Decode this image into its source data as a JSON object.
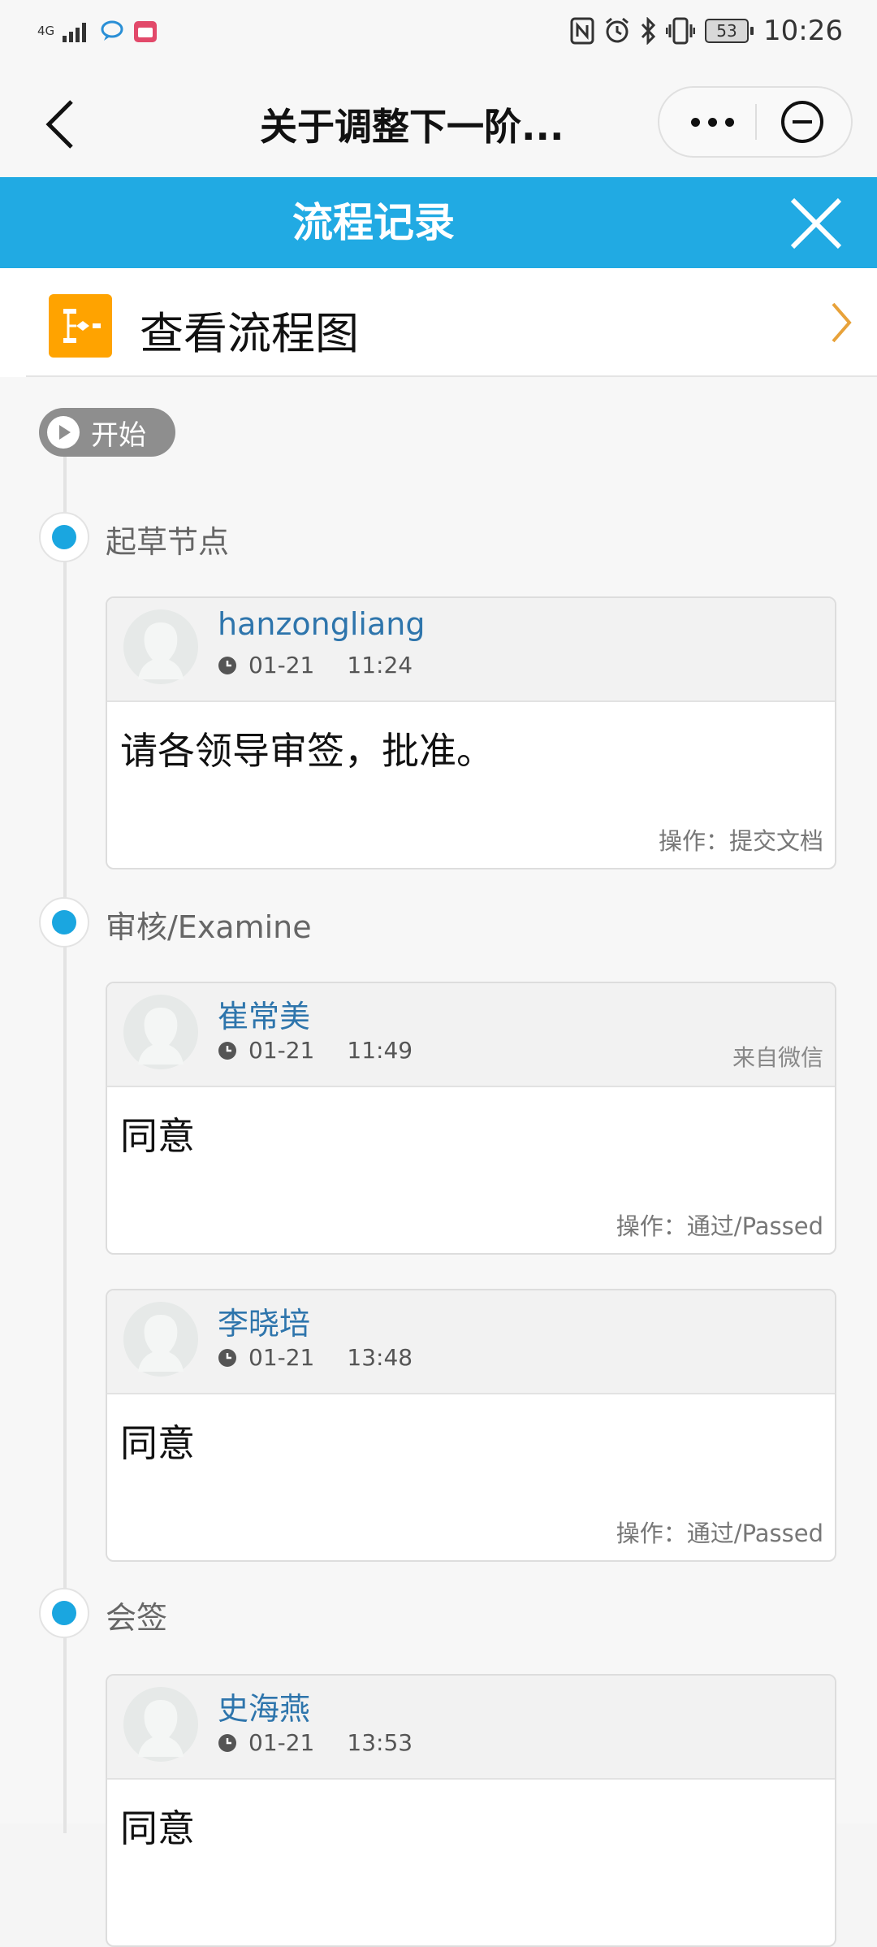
{
  "status_bar": {
    "network": "4G",
    "battery": "53",
    "time": "10:26"
  },
  "nav": {
    "title": "关于调整下一阶..."
  },
  "header": {
    "title": "流程记录"
  },
  "view_diagram": {
    "label": "查看流程图"
  },
  "start": {
    "label": "开始"
  },
  "nodes": [
    {
      "label": "起草节点",
      "entries": [
        {
          "user": "hanzongliang",
          "date": "01-21",
          "time": "11:24",
          "source": "",
          "comment": "请各领导审签，批准。",
          "operation": "操作：提交文档"
        }
      ]
    },
    {
      "label": "审核/Examine",
      "entries": [
        {
          "user": "崔常美",
          "date": "01-21",
          "time": "11:49",
          "source": "来自微信",
          "comment": "同意",
          "operation": "操作：通过/Passed"
        },
        {
          "user": "李晓培",
          "date": "01-21",
          "time": "13:48",
          "source": "",
          "comment": "同意",
          "operation": "操作：通过/Passed"
        }
      ]
    },
    {
      "label": "会签",
      "entries": [
        {
          "user": "史海燕",
          "date": "01-21",
          "time": "13:53",
          "source": "",
          "comment": "同意",
          "operation": ""
        }
      ]
    }
  ],
  "colors": {
    "accent_blue": "#21aae3",
    "node_dot": "#1aa6e0",
    "diagram_icon": "#ffa300",
    "user_name": "#2e75ac"
  },
  "icons": [
    "back-arrow-icon",
    "more-icon",
    "minimize-icon",
    "close-icon",
    "flowchart-icon",
    "chevron-right-icon",
    "play-icon",
    "clock-icon",
    "avatar-placeholder-icon"
  ]
}
